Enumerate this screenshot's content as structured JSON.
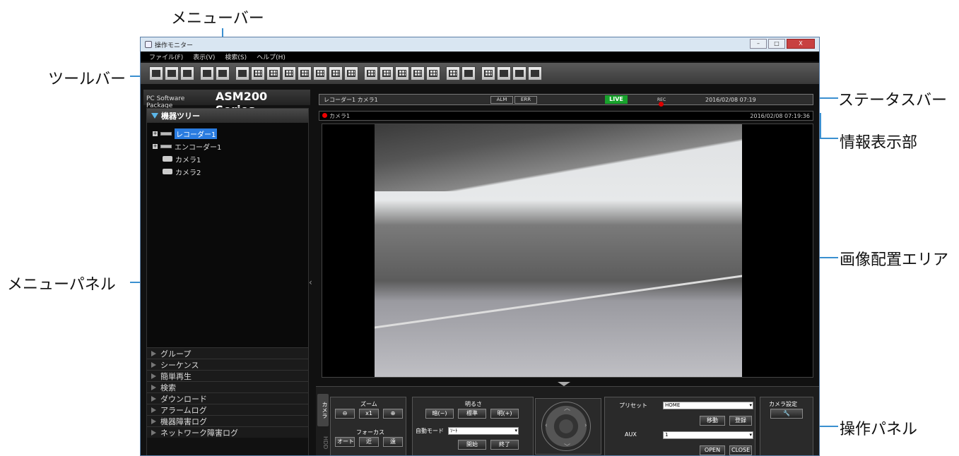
{
  "callouts": {
    "menubar": "メニューバー",
    "toolbar": "ツールバー",
    "menupanel": "メニューパネル",
    "statusbar": "ステータスバー",
    "info": "情報表示部",
    "imagearea": "画像配置エリア",
    "oppanel": "操作パネル"
  },
  "window": {
    "title": "操作モニター",
    "buttons": [
      "–",
      "□",
      "X"
    ]
  },
  "menu": [
    "ファイル(F)",
    "表示(V)",
    "検索(S)",
    "ヘルプ(H)"
  ],
  "logo": {
    "small": "PC Software Package",
    "big": "ASM200 Series"
  },
  "sidebar": {
    "tree_title": "機器ツリー",
    "tree": [
      "レコーダー1",
      "エンコーダー1",
      "カメラ1",
      "カメラ2"
    ],
    "groups": [
      "グループ",
      "シーケンス",
      "簡単再生",
      "検索",
      "ダウンロード",
      "アラームログ",
      "機器障害ログ",
      "ネットワーク障害ログ"
    ]
  },
  "status": {
    "camera": "レコーダー1 カメラ1",
    "alm": "ALM",
    "err": "ERR",
    "live": "LIVE",
    "rec": "REC",
    "date": "2016/02/08 07:19"
  },
  "info": {
    "camera": "カメラ1",
    "datetime": "2016/02/08 07:19:36"
  },
  "ops": {
    "tab_camera": "カメラ",
    "tab_hdd": "HDD",
    "zoom_label": "ズーム",
    "zoom_x1": "x1",
    "focus_label": "フォーカス",
    "focus_auto": "オート",
    "focus_near": "近",
    "focus_far": "遠",
    "brightness_label": "明るさ",
    "bright_dark": "暗(−)",
    "bright_std": "標準",
    "bright_light": "明(+)",
    "automode_label": "自動モード",
    "automode_value": "ｿｰﾄ",
    "start": "開始",
    "end": "終了",
    "preset_label": "プリセット",
    "preset_value": "HOME",
    "move": "移動",
    "register": "登録",
    "aux_label": "AUX",
    "aux_value": "1",
    "open": "OPEN",
    "close": "CLOSE",
    "camset_label": "カメラ設定"
  }
}
